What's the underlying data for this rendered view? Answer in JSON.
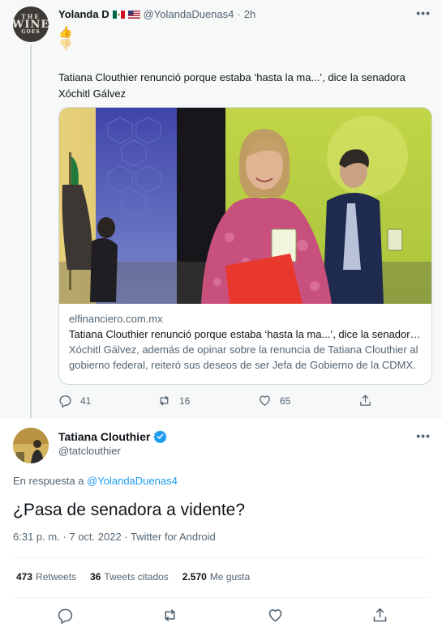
{
  "parent_tweet": {
    "author_name": "Yolanda D",
    "author_handle": "@YolandaDuenas4",
    "separator": "·",
    "time": "2h",
    "emoji_1": "👍",
    "emoji_2": "👎",
    "text": "Tatiana Clouthier renunció porque estaba ‘hasta la ma...’, dice la senadora Xóchitl Gálvez",
    "avatar_text": [
      "THE",
      "WINE",
      "GOES"
    ],
    "card": {
      "domain": "elfinanciero.com.mx",
      "title": "Tatiana Clouthier renunció porque estaba ‘hasta la ma...’, dice la senadora Xóchitl Gálvez",
      "description": "Xóchitl Gálvez, además de opinar sobre la renuncia de Tatiana Clouthier al gobierno federal, reiteró sus deseos de ser Jefa de Gobierno de la CDMX."
    },
    "actions": {
      "replies": "41",
      "retweets": "16",
      "likes": "65"
    }
  },
  "main_tweet": {
    "author_name": "Tatiana Clouthier",
    "author_handle": "@tatclouthier",
    "reply_prefix": "En respuesta a",
    "reply_to": "@YolandaDuenas4",
    "text": "¿Pasa de senadora a vidente?",
    "meta": "6:31 p. m. · 7 oct. 2022 · Twitter for Android",
    "stats": {
      "retweets_count": "473",
      "retweets_label": "Retweets",
      "quotes_count": "36",
      "quotes_label": "Tweets citados",
      "likes_count": "2.570",
      "likes_label": "Me gusta"
    }
  },
  "icons": [
    "more-icon",
    "reply-icon",
    "retweet-icon",
    "like-icon",
    "share-icon",
    "verified-badge-icon"
  ],
  "colors": {
    "accent": "#1d9bf0",
    "muted": "#536471",
    "text": "#0f1419",
    "parent_bg": "#f7f9f9"
  }
}
